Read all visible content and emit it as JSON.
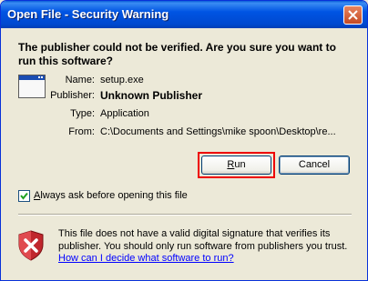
{
  "window": {
    "title": "Open File - Security Warning"
  },
  "question": "The publisher could not be verified.  Are you sure you want to run this software?",
  "fields": [
    {
      "label": "Name:",
      "value": "setup.exe"
    },
    {
      "label": "Publisher:",
      "value": "Unknown Publisher"
    },
    {
      "label": "Type:",
      "value": "Application"
    },
    {
      "label": "From:",
      "value": "C:\\Documents and Settings\\mike spoon\\Desktop\\re..."
    }
  ],
  "buttons": {
    "run_mnemonic": "R",
    "run_rest": "un",
    "cancel_label": "Cancel"
  },
  "checkbox": {
    "checked": true,
    "mnemonic": "A",
    "label_rest": "lways ask before opening this file"
  },
  "warning": {
    "text": "This file does not have a valid digital signature that verifies its publisher.  You should only run software from publishers you trust.",
    "link": "How can I decide what software to run?"
  },
  "colors": {
    "titlebar": "#0054e3",
    "highlight_border": "#ee0000",
    "link": "#0000ff",
    "shield": "#c0272d"
  },
  "icons": [
    "close-icon",
    "application-window-icon",
    "checkmark-icon",
    "security-shield-icon"
  ]
}
